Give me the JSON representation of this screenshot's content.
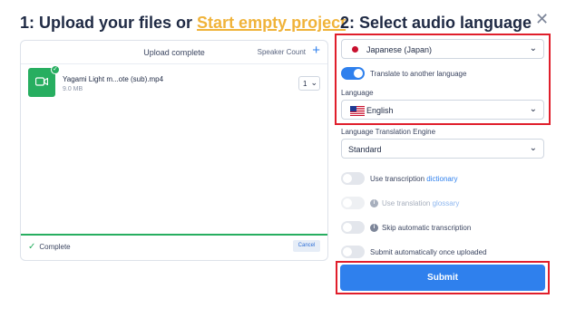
{
  "left": {
    "title_prefix": "1: Upload your files or",
    "title_link": "Start empty project",
    "panel": {
      "header": "Upload complete",
      "speaker_count_label": "Speaker Count",
      "add_icon": "plus-icon",
      "file": {
        "name": "Yagami Light m...ote (sub).mp4",
        "size": "9.0 MB",
        "speaker_count": "1"
      },
      "status": "Complete",
      "cancel_label": "Cancel"
    }
  },
  "right": {
    "title": "2: Select audio language",
    "source_language": "Japanese (Japan)",
    "translate_toggle_label": "Translate to another language",
    "language_label": "Language",
    "target_language": "English",
    "engine_label": "Language Translation Engine",
    "engine_value": "Standard",
    "options": {
      "dictionary_prefix": "Use transcription",
      "dictionary_link": "dictionary",
      "glossary_prefix": "Use translation",
      "glossary_link": "glossary",
      "skip_transcription": "Skip automatic transcription",
      "auto_submit": "Submit automatically once uploaded"
    },
    "submit_label": "Submit"
  },
  "colors": {
    "accent": "#2f80ed",
    "link": "#f0b33a",
    "success": "#27ae60",
    "highlight": "#e01e2b"
  }
}
